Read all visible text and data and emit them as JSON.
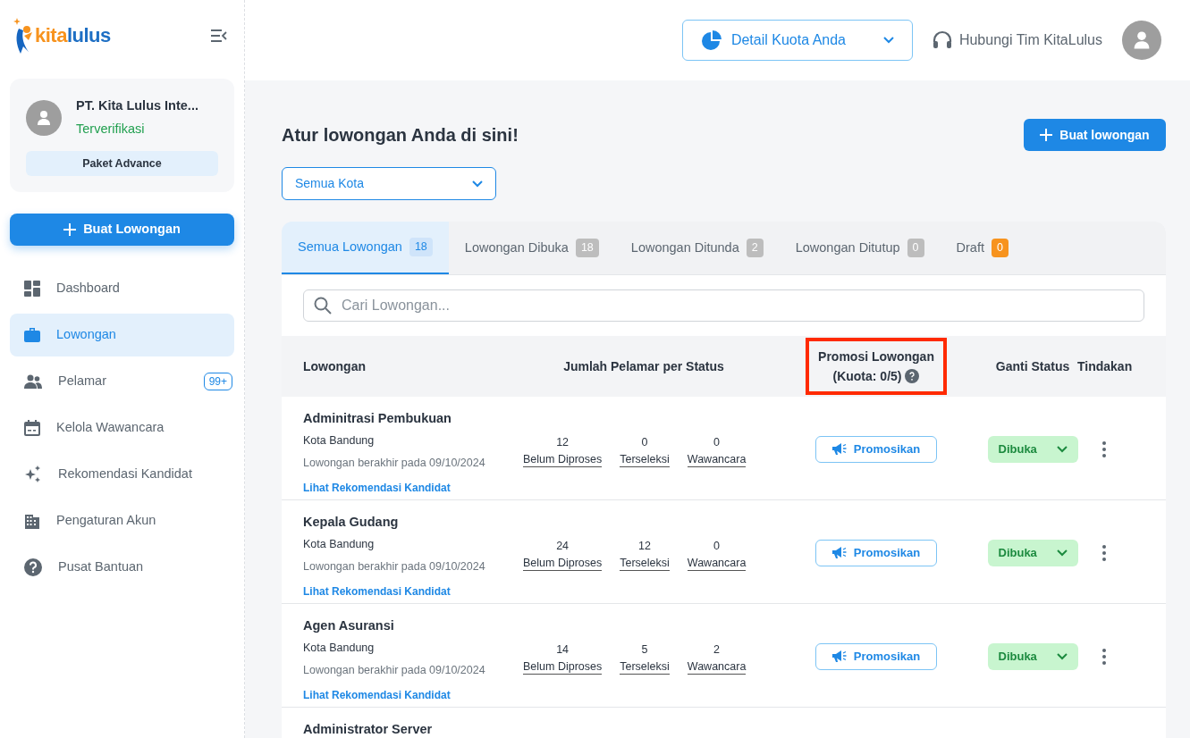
{
  "logo": [
    "kita",
    "lulus"
  ],
  "company": {
    "name": "PT. Kita Lulus Inte...",
    "verification": "Terverifikasi",
    "package": "Paket Advance"
  },
  "sidebar": {
    "create_button": "Buat Lowongan",
    "items": [
      {
        "label": "Dashboard",
        "selected": false
      },
      {
        "label": "Lowongan",
        "selected": true
      },
      {
        "label": "Pelamar",
        "selected": false,
        "badge": "99+"
      },
      {
        "label": "Kelola Wawancara",
        "selected": false
      },
      {
        "label": "Rekomendasi Kandidat",
        "selected": false
      },
      {
        "label": "Pengaturan Akun",
        "selected": false
      },
      {
        "label": "Pusat Bantuan",
        "selected": false
      }
    ]
  },
  "topbar": {
    "quota_button": "Detail Kuota Anda",
    "contact": "Hubungi Tim KitaLulus"
  },
  "page": {
    "title": "Atur lowongan Anda di sini!",
    "create_button": "Buat lowongan",
    "city_select": "Semua Kota"
  },
  "tabs": [
    {
      "label": "Semua Lowongan",
      "count": "18",
      "selected": true,
      "color": "#cfe4fa"
    },
    {
      "label": "Lowongan Dibuka",
      "count": "18",
      "selected": false,
      "color": "#bdbdbd"
    },
    {
      "label": "Lowongan Ditunda",
      "count": "2",
      "selected": false,
      "color": "#bdbdbd"
    },
    {
      "label": "Lowongan Ditutup",
      "count": "0",
      "selected": false,
      "color": "#bdbdbd"
    },
    {
      "label": "Draft",
      "count": "0",
      "selected": false,
      "color": "#f7931e"
    }
  ],
  "search": {
    "placeholder": "Cari Lowongan..."
  },
  "table": {
    "columns": [
      {
        "label": "Lowongan",
        "highlighted": false
      },
      {
        "label": "Jumlah Pelamar per Status",
        "highlighted": false
      },
      {
        "label": "Promosi Lowongan",
        "sublabel": "(Kuota: 0/5)",
        "highlighted": true
      },
      {
        "label": "Ganti Status",
        "highlighted": false
      },
      {
        "label": "Tindakan",
        "highlighted": false
      }
    ],
    "rows": [
      {
        "title": "Adminitrasi Pembukuan",
        "city": "Kota Bandung",
        "deadline": "Lowongan berakhir pada 09/10/2024",
        "link": "Lihat Rekomendasi Kandidat",
        "stats": [
          {
            "value": "12",
            "label": "Belum Diproses"
          },
          {
            "value": "0",
            "label": "Terseleksi"
          },
          {
            "value": "0",
            "label": "Wawancara"
          }
        ],
        "promote": "Promosikan",
        "status": "Dibuka"
      },
      {
        "title": "Kepala Gudang",
        "city": "Kota Bandung",
        "deadline": "Lowongan berakhir pada 09/10/2024",
        "link": "Lihat Rekomendasi Kandidat",
        "stats": [
          {
            "value": "24",
            "label": "Belum Diproses"
          },
          {
            "value": "12",
            "label": "Terseleksi"
          },
          {
            "value": "0",
            "label": "Wawancara"
          }
        ],
        "promote": "Promosikan",
        "status": "Dibuka"
      },
      {
        "title": "Agen Asuransi",
        "city": "Kota Bandung",
        "deadline": "Lowongan berakhir pada 09/10/2024",
        "link": "Lihat Rekomendasi Kandidat",
        "stats": [
          {
            "value": "14",
            "label": "Belum Diproses"
          },
          {
            "value": "5",
            "label": "Terseleksi"
          },
          {
            "value": "2",
            "label": "Wawancara"
          }
        ],
        "promote": "Promosikan",
        "status": "Dibuka"
      },
      {
        "title": "Administrator Server"
      }
    ]
  }
}
